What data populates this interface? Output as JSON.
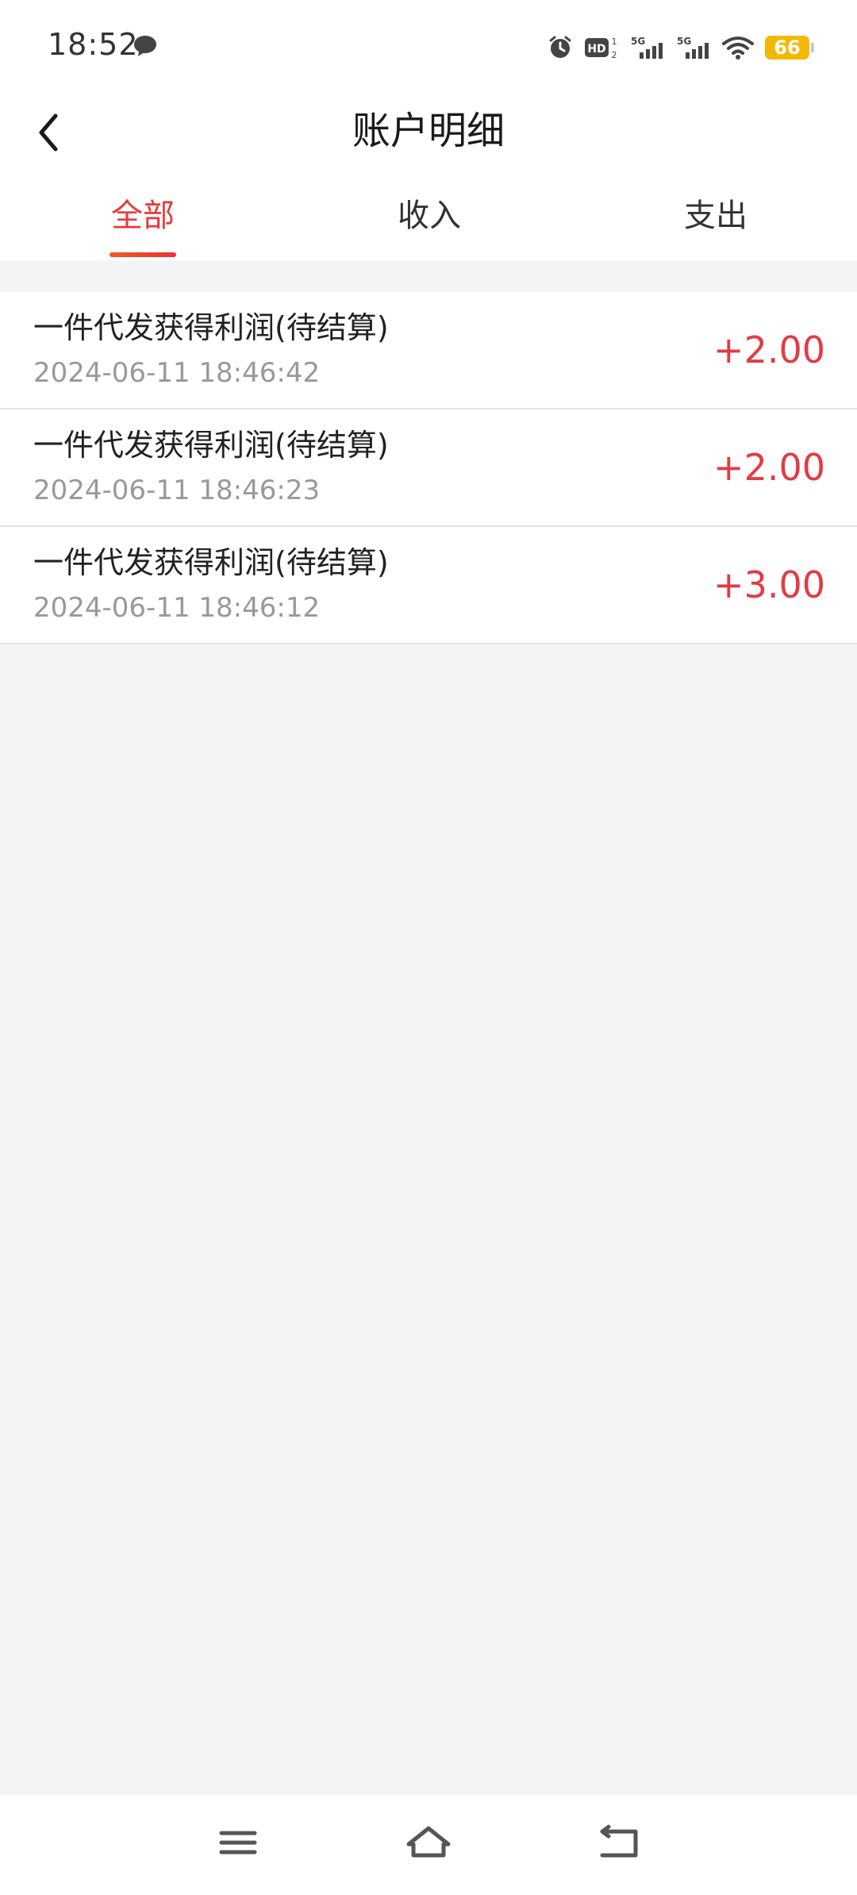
{
  "status_bar": {
    "time": "18:52",
    "battery": "66",
    "icons": [
      "message-icon",
      "alarm-icon",
      "hd-icon",
      "signal-5g-icon",
      "signal-5g-icon",
      "wifi-icon",
      "battery-icon"
    ]
  },
  "header": {
    "title": "账户明细",
    "back_icon": "chevron-left-icon"
  },
  "tabs": [
    {
      "label": "全部",
      "active": true
    },
    {
      "label": "收入",
      "active": false
    },
    {
      "label": "支出",
      "active": false
    }
  ],
  "transactions": [
    {
      "title": "一件代发获得利润(待结算)",
      "time": "2024-06-11 18:46:42",
      "amount": "+2.00"
    },
    {
      "title": "一件代发获得利润(待结算)",
      "time": "2024-06-11 18:46:23",
      "amount": "+2.00"
    },
    {
      "title": "一件代发获得利润(待结算)",
      "time": "2024-06-11 18:46:12",
      "amount": "+3.00"
    }
  ],
  "nav_bar": {
    "icons": [
      "menu-icon",
      "home-icon",
      "back-icon"
    ]
  },
  "colors": {
    "accent": "#e53b3b",
    "amount": "#e33b45",
    "background": "#f4f4f4",
    "battery": "#f5b800"
  }
}
